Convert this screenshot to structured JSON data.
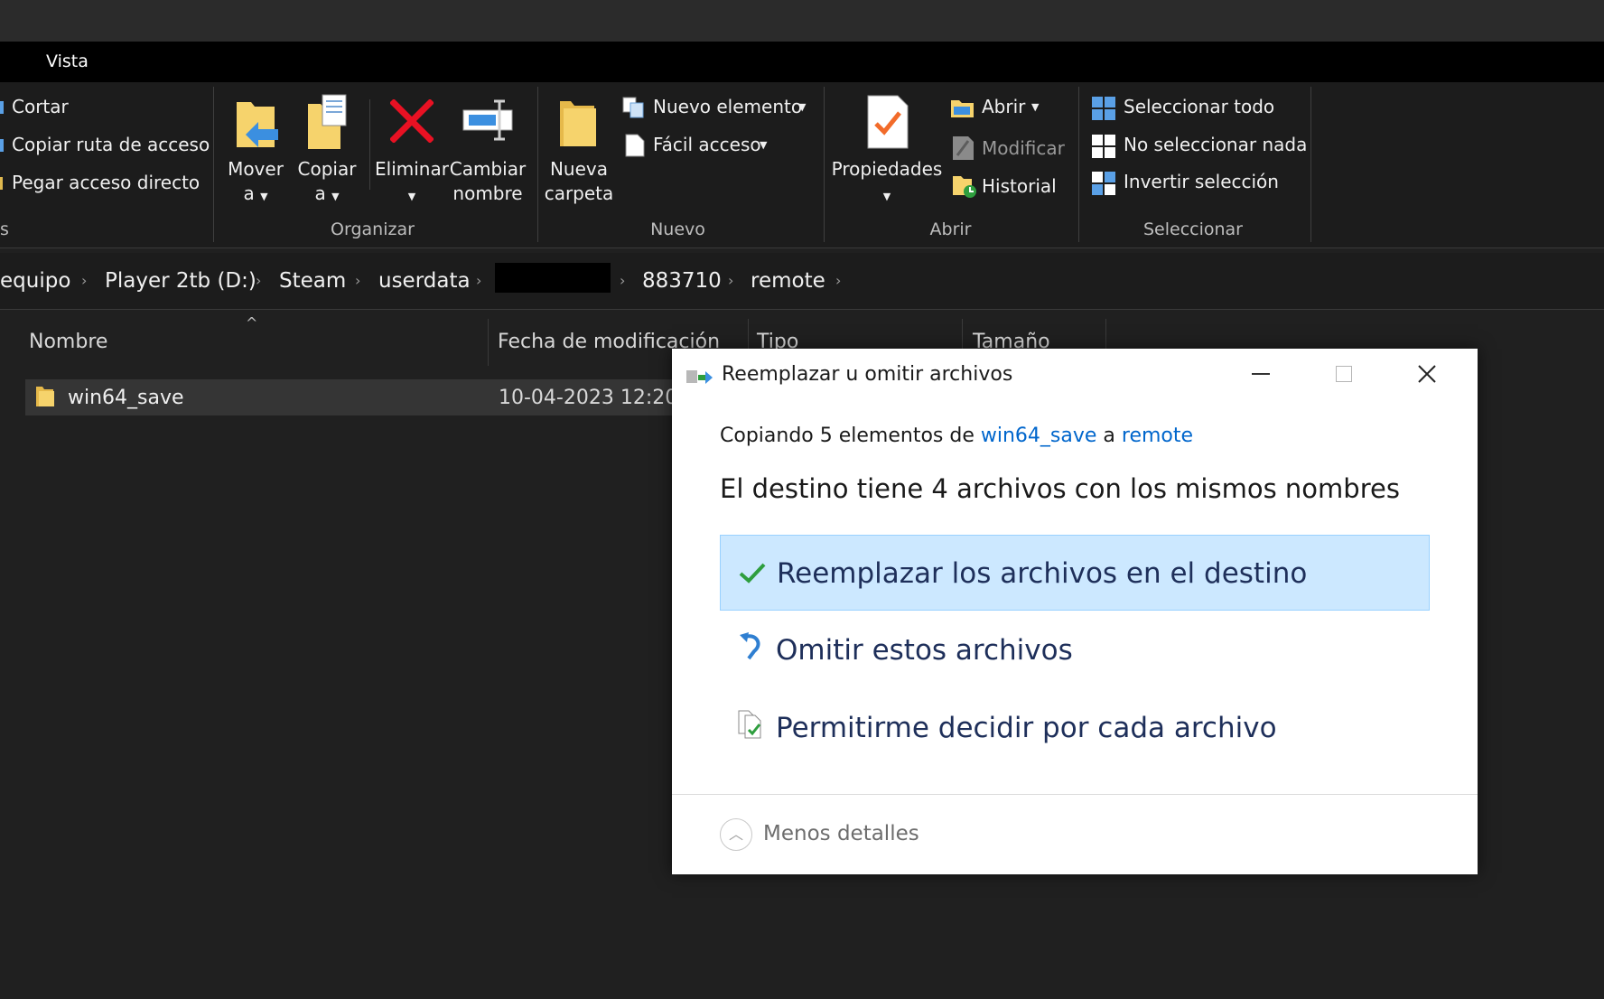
{
  "menu": {
    "vista": "Vista"
  },
  "ribbon": {
    "clipboard": {
      "cut": "Cortar",
      "copy_path": "Copiar ruta de acceso",
      "paste_shortcut": "Pegar acceso directo",
      "group_tail": "s"
    },
    "organize": {
      "group": "Organizar",
      "move_1": "Mover",
      "move_2": "a",
      "copy_1": "Copiar",
      "copy_2": "a",
      "delete": "Eliminar",
      "rename_1": "Cambiar",
      "rename_2": "nombre"
    },
    "new": {
      "group": "Nuevo",
      "folder_1": "Nueva",
      "folder_2": "carpeta",
      "new_item": "Nuevo elemento",
      "easy_access": "Fácil acceso"
    },
    "open": {
      "group": "Abrir",
      "properties": "Propiedades",
      "open": "Abrir",
      "edit": "Modificar",
      "history": "Historial"
    },
    "select": {
      "group": "Seleccionar",
      "select_all": "Seleccionar todo",
      "select_none": "No seleccionar nada",
      "invert": "Invertir selección"
    }
  },
  "breadcrumb": [
    "equipo",
    "Player 2tb (D:)",
    "Steam",
    "userdata",
    "883710",
    "remote"
  ],
  "columns": {
    "name": "Nombre",
    "date": "Fecha de modificación",
    "type": "Tipo",
    "size": "Tamaño"
  },
  "files": [
    {
      "name": "win64_save",
      "date": "10-04-2023 12:20"
    }
  ],
  "dialog": {
    "title": "Reemplazar u omitir archivos",
    "copying_prefix": "Copiando 5 elementos de",
    "source": "win64_save",
    "connector": "a",
    "dest": "remote",
    "heading": "El destino tiene 4 archivos con los mismos nombres",
    "option_replace": "Reemplazar los archivos en el destino",
    "option_skip": "Omitir estos archivos",
    "option_decide": "Permitirme decidir por cada archivo",
    "less_details": "Menos detalles"
  },
  "colors": {
    "link": "#0066cc",
    "highlight": "#cce8ff",
    "highlight_border": "#99d1ff",
    "check": "#2e9e3e",
    "delete_red": "#e81123"
  }
}
